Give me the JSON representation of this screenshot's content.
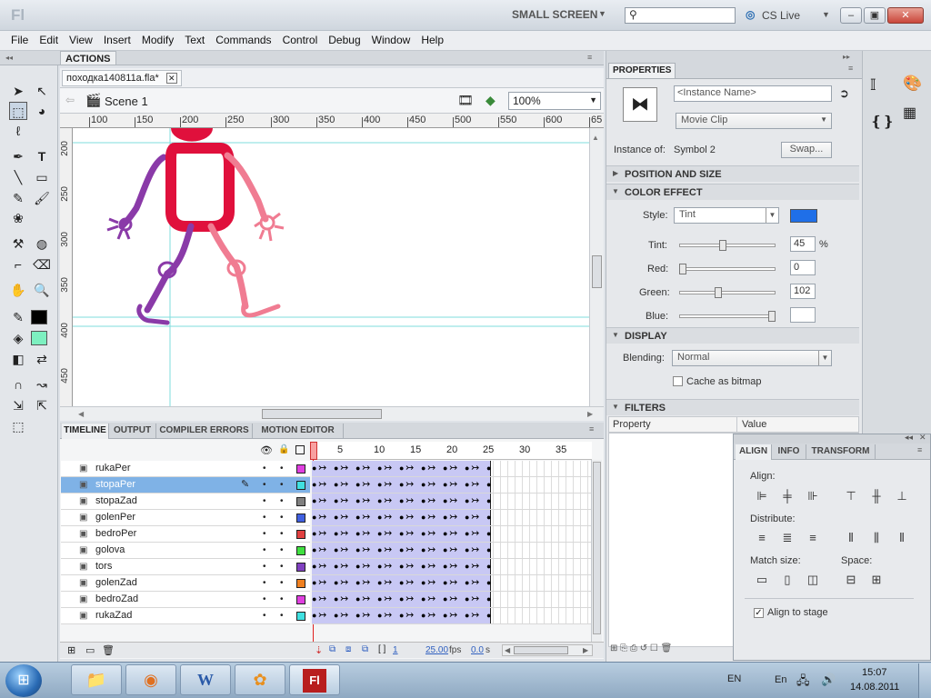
{
  "app": {
    "logo": "Fl",
    "workspace": "SMALL SCREEN",
    "search_placeholder": "",
    "cs_live": "CS Live"
  },
  "menu": [
    "File",
    "Edit",
    "View",
    "Insert",
    "Modify",
    "Text",
    "Commands",
    "Control",
    "Debug",
    "Window",
    "Help"
  ],
  "actions_tab": "ACTIONS",
  "document": {
    "tab_name": "походка140811a.fla*",
    "scene": "Scene 1",
    "zoom": "100%"
  },
  "ruler": {
    "top": [
      "100",
      "150",
      "200",
      "250",
      "300",
      "350",
      "400",
      "450",
      "500",
      "550",
      "600",
      "65"
    ],
    "left": [
      "200",
      "250",
      "300",
      "350",
      "400",
      "450"
    ]
  },
  "bottom_tabs": [
    "TIMELINE",
    "OUTPUT",
    "COMPILER ERRORS",
    "MOTION EDITOR"
  ],
  "timeline": {
    "frame_numbers": [
      "1",
      "5",
      "10",
      "15",
      "20",
      "25",
      "30",
      "35"
    ],
    "layers": [
      {
        "name": "rukaPer",
        "color": "#e040e0"
      },
      {
        "name": "stopaPer",
        "color": "#40e0e0"
      },
      {
        "name": "stopaZad",
        "color": "#808080"
      },
      {
        "name": "golenPer",
        "color": "#4060e0"
      },
      {
        "name": "bedroPer",
        "color": "#e04040"
      },
      {
        "name": "golova",
        "color": "#40e040"
      },
      {
        "name": "tors",
        "color": "#8040c0"
      },
      {
        "name": "golenZad",
        "color": "#f08020"
      },
      {
        "name": "bedroZad",
        "color": "#e040e0"
      },
      {
        "name": "rukaZad",
        "color": "#40e0e0"
      }
    ],
    "current_frame": "1",
    "fps": "25.00",
    "fps_unit": "fps",
    "time": "0.0",
    "time_unit": "s"
  },
  "properties": {
    "tab": "PROPERTIES",
    "instance_name_placeholder": "<Instance Name>",
    "type": "Movie Clip",
    "instance_of_label": "Instance of:",
    "instance_of": "Symbol 2",
    "swap": "Swap...",
    "pos_size": "POSITION AND SIZE",
    "color_effect": "COLOR EFFECT",
    "style_label": "Style:",
    "style_value": "Tint",
    "tint_color": "#1f6fe8",
    "tint_label": "Tint:",
    "tint_value": "45",
    "tint_level": 0.45,
    "tint_unit": "%",
    "red_label": "Red:",
    "red_value": "0",
    "red_level": 0,
    "green_label": "Green:",
    "green_value": "102",
    "green_level": 0.4,
    "blue_label": "Blue:",
    "blue_value": "",
    "blue_level": 1,
    "display": "DISPLAY",
    "blending_label": "Blending:",
    "blending_value": "Normal",
    "cache_label": "Cache as bitmap",
    "filters": "FILTERS",
    "col_property": "Property",
    "col_value": "Value"
  },
  "align_panel": {
    "tabs": [
      "ALIGN",
      "INFO",
      "TRANSFORM"
    ],
    "align_label": "Align:",
    "distribute_label": "Distribute:",
    "match_label": "Match size:",
    "space_label": "Space:",
    "stage_label": "Align to stage"
  },
  "taskbar": {
    "lang": "EN",
    "lang2": "En",
    "time": "15:07",
    "date": "14.08.2011"
  }
}
